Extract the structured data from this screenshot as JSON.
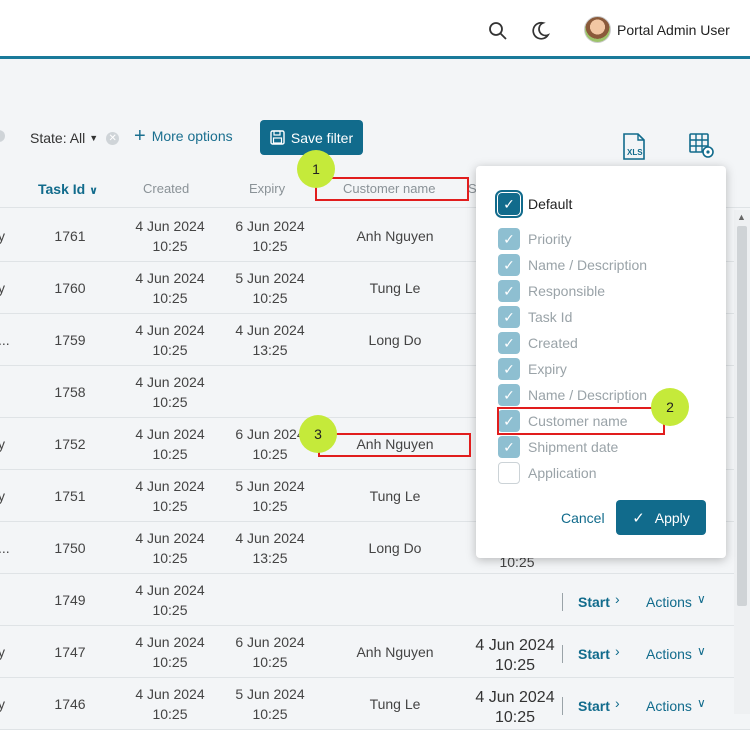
{
  "header": {
    "user_name": "Portal Admin User",
    "search_icon": "search-icon",
    "theme_icon": "moon-icon"
  },
  "toolbar": {
    "state_label": "State: All",
    "more_options_label": "More options",
    "save_filter_label": "Save filter",
    "xls_icon": "xls-export-icon",
    "grid_settings_icon": "table-settings-icon"
  },
  "table": {
    "columns": {
      "task_id": "Task Id",
      "created": "Created",
      "expiry": "Expiry",
      "customer_name": "Customer name",
      "next_col_initial": "S"
    },
    "rows": [
      {
        "lead": "y",
        "id": "1761",
        "created_date": "4 Jun 2024",
        "created_time": "10:25",
        "expiry_date": "6 Jun 2024",
        "expiry_time": "10:25",
        "customer": "Anh Nguyen"
      },
      {
        "lead": "y",
        "id": "1760",
        "created_date": "4 Jun 2024",
        "created_time": "10:25",
        "expiry_date": "5 Jun 2024",
        "expiry_time": "10:25",
        "customer": "Tung Le"
      },
      {
        "lead": "...",
        "id": "1759",
        "created_date": "4 Jun 2024",
        "created_time": "10:25",
        "expiry_date": "4 Jun 2024",
        "expiry_time": "13:25",
        "customer": "Long Do"
      },
      {
        "lead": "",
        "id": "1758",
        "created_date": "4 Jun 2024",
        "created_time": "10:25",
        "expiry_date": "",
        "expiry_time": "",
        "customer": ""
      },
      {
        "lead": "y",
        "id": "1752",
        "created_date": "4 Jun 2024",
        "created_time": "10:25",
        "expiry_date": "6 Jun 2024",
        "expiry_time": "10:25",
        "customer": "Anh Nguyen"
      },
      {
        "lead": "y",
        "id": "1751",
        "created_date": "4 Jun 2024",
        "created_time": "10:25",
        "expiry_date": "5 Jun 2024",
        "expiry_time": "10:25",
        "customer": "Tung Le"
      },
      {
        "lead": "...",
        "id": "1750",
        "created_date": "4 Jun 2024",
        "created_time": "10:25",
        "expiry_date": "4 Jun 2024",
        "expiry_time": "13:25",
        "customer": "Long Do"
      },
      {
        "lead": "",
        "id": "1749",
        "created_date": "4 Jun 2024",
        "created_time": "10:25",
        "expiry_date": "",
        "expiry_time": "",
        "customer": ""
      },
      {
        "lead": "y",
        "id": "1747",
        "created_date": "4 Jun 2024",
        "created_time": "10:25",
        "expiry_date": "6 Jun 2024",
        "expiry_time": "10:25",
        "customer": "Anh Nguyen"
      },
      {
        "lead": "y",
        "id": "1746",
        "created_date": "4 Jun 2024",
        "created_time": "10:25",
        "expiry_date": "5 Jun 2024",
        "expiry_time": "10:25",
        "customer": "Tung Le"
      }
    ],
    "row_actions": {
      "start_label": "Start",
      "actions_label": "Actions",
      "shipment_dates": [
        "",
        "4 Jun 2024",
        "4 Jun 2024"
      ],
      "shipment_times": [
        "10:25",
        "10:25",
        "10:25"
      ]
    }
  },
  "column_panel": {
    "default_label": "Default",
    "options": [
      {
        "label": "Priority",
        "checked": true
      },
      {
        "label": "Name / Description",
        "checked": true
      },
      {
        "label": "Responsible",
        "checked": true
      },
      {
        "label": "Task Id",
        "checked": true
      },
      {
        "label": "Created",
        "checked": true
      },
      {
        "label": "Expiry",
        "checked": true
      },
      {
        "label": "Name / Description",
        "checked": true
      },
      {
        "label": "Customer name",
        "checked": true
      },
      {
        "label": "Shipment date",
        "checked": true
      },
      {
        "label": "Application",
        "checked": false
      }
    ],
    "cancel_label": "Cancel",
    "apply_label": "Apply"
  },
  "annotations": {
    "badge_1": "1",
    "badge_2": "2",
    "badge_3": "3",
    "highlight_color": "#e11d1d",
    "badge_color": "#c5ea3a"
  },
  "colors": {
    "accent": "#116b8c"
  }
}
